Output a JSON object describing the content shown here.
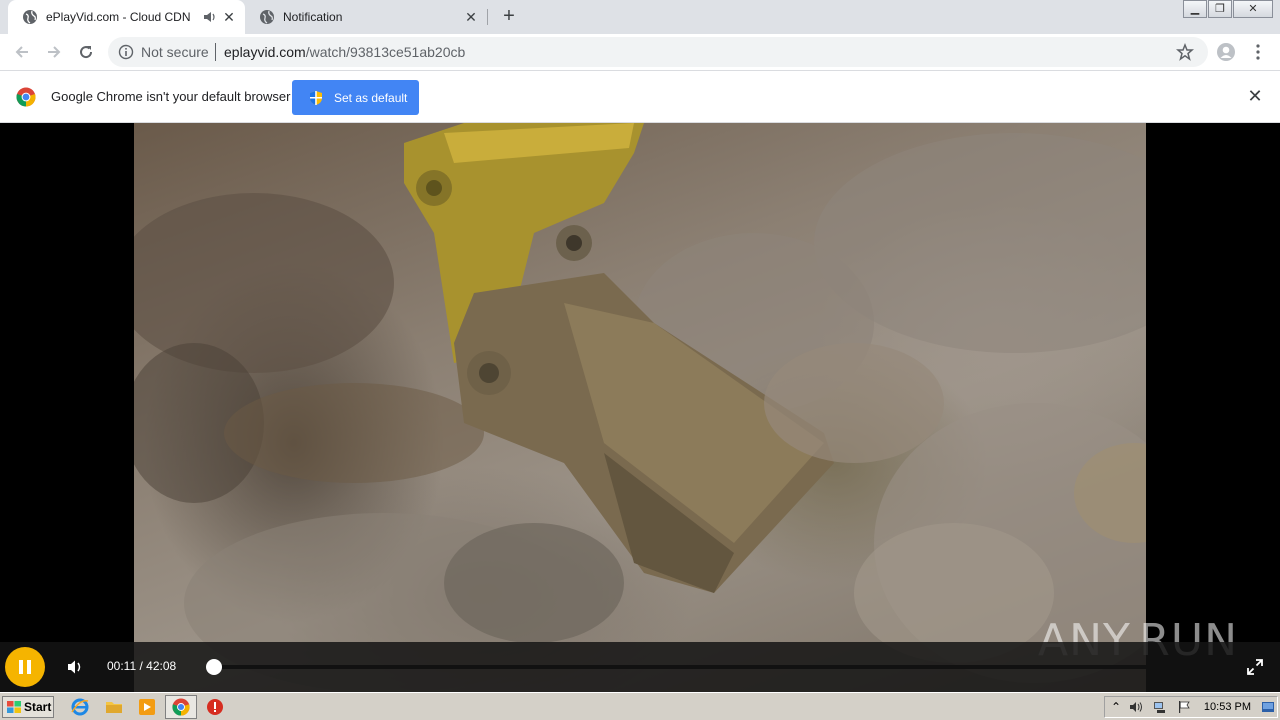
{
  "browser": {
    "tabs": [
      {
        "title": "ePlayVid.com - Cloud CDN",
        "active": true,
        "audio": true
      },
      {
        "title": "Notification",
        "active": false,
        "audio": false
      }
    ],
    "new_tab_label": "+",
    "url_security": "Not secure",
    "url_domain": "eplayvid.com",
    "url_path": "/watch/93813ce51ab20cb"
  },
  "infobar": {
    "message": "Google Chrome isn't your default browser",
    "button_label": "Set as default"
  },
  "player": {
    "current_time": "00:11",
    "duration": "42:08",
    "time_display": "00:11 / 42:08",
    "progress_fraction": 0.004,
    "state": "playing"
  },
  "watermark": {
    "left": "ANY",
    "right": "RUN"
  },
  "taskbar": {
    "start_label": "Start",
    "clock": "10:53 PM"
  },
  "colors": {
    "accent_play": "#f5b400",
    "infobar_button": "#4285f4",
    "tabstrip": "#dee1e6"
  }
}
